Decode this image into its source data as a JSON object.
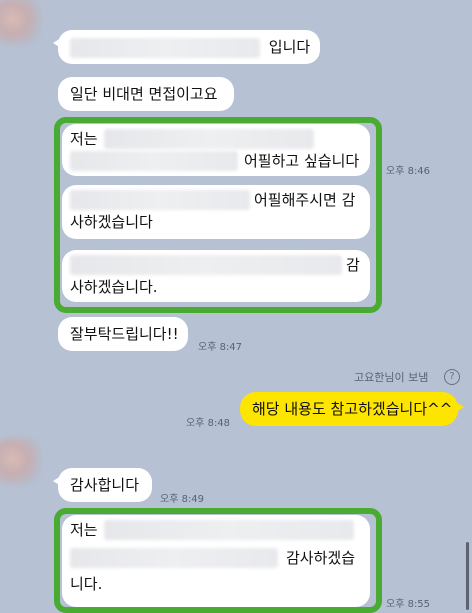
{
  "messages": {
    "m1_suffix": "입니다",
    "m2": "일단 비대면 면접이고요",
    "m3_prefix": "저는",
    "m3_suffix": "어필하고 싶습니다",
    "m4_suffix_line1": "어필해주시면 감",
    "m4_line2": "사하겠습니다",
    "m5_suffix_line1": "감",
    "m5_line2": "사하겠습니다.",
    "m6": "잘부탁드립니다!!",
    "m7": "해당 내용도 참고하겠습니다^^",
    "m8": "감사합니다",
    "m9_prefix": "저는",
    "m9_suffix_line2": "감사하겠습",
    "m9_line3": "니다."
  },
  "times": {
    "t1": "오후 8:46",
    "t2": "오후 8:47",
    "t3": "오후 8:48",
    "t4": "오후 8:49",
    "t5": "오후 8:55"
  },
  "sender_line": {
    "label": "고요한님이 보냄",
    "icon": "question-circle-icon",
    "icon_glyph": "?"
  },
  "colors": {
    "background": "#b6c2d4",
    "incoming_bubble": "#ffffff",
    "outgoing_bubble": "#fee500",
    "highlight_frame": "#4aab33"
  }
}
